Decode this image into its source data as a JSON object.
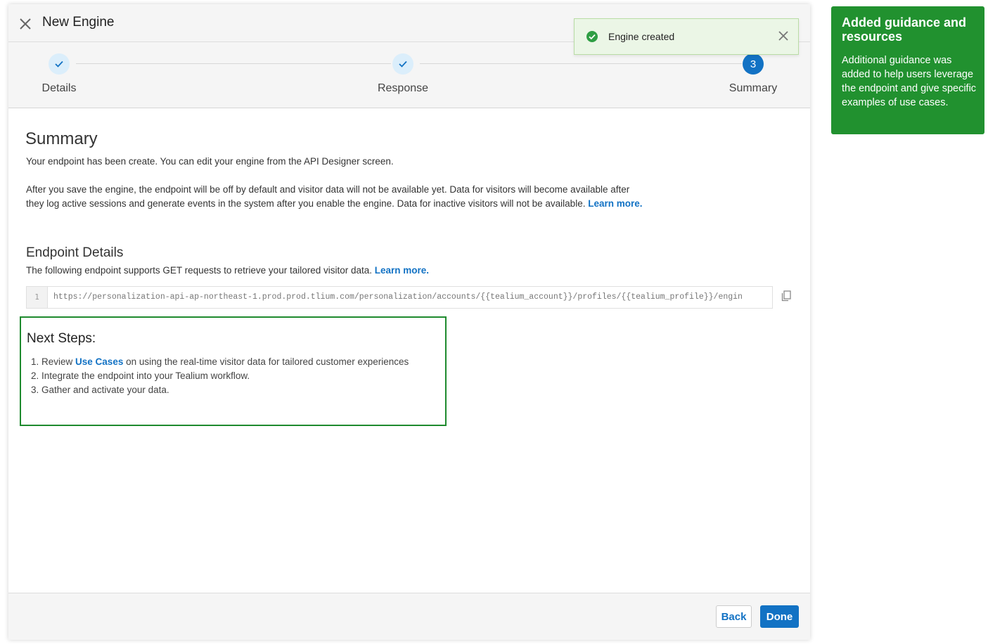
{
  "modal": {
    "title": "New Engine"
  },
  "stepper": {
    "steps": [
      {
        "label": "Details",
        "state": "done"
      },
      {
        "label": "Response",
        "state": "done"
      },
      {
        "label": "Summary",
        "state": "active",
        "number": "3"
      }
    ]
  },
  "toast": {
    "text": "Engine created",
    "color": "#2f9e44"
  },
  "summary": {
    "heading": "Summary",
    "para1": "Your endpoint has been create. You can edit your engine from the API Designer screen.",
    "para2_line1": "After you save the engine, the endpoint will be off by default and visitor data will not be available yet. Data for visitors will become available after",
    "para2_line2": "they log active sessions and generate events in the system after you enable the engine. Data for inactive visitors will not be available.",
    "para2_link": "Learn more."
  },
  "endpoint": {
    "heading": "Endpoint Details",
    "desc": "The following endpoint supports GET requests to retrieve your tailored visitor data.",
    "desc_link": "Learn more.",
    "line_number": "1",
    "url": "https://personalization-api-ap-northeast-1.prod.prod.tlium.com/personalization/accounts/{{tealium_account}}/profiles/{{tealium_profile}}/engin"
  },
  "next_steps": {
    "heading": "Next Steps:",
    "item1_prefix": "1. Review ",
    "item1_link": "Use Cases",
    "item1_suffix": " on using the real-time visitor data for tailored customer experiences",
    "item2": "2. Integrate the endpoint into your Tealium workflow.",
    "item3": "3. Gather and activate your data."
  },
  "footer": {
    "back_label": "Back",
    "done_label": "Done"
  },
  "annotation": {
    "title": "Added guidance and resources",
    "body": "Additional guidance was added to help users leverage the endpoint and give specific examples of use cases.",
    "color": "#21912f"
  },
  "colors": {
    "accent": "#1272c4",
    "highlight_border": "#1e8a2e"
  }
}
